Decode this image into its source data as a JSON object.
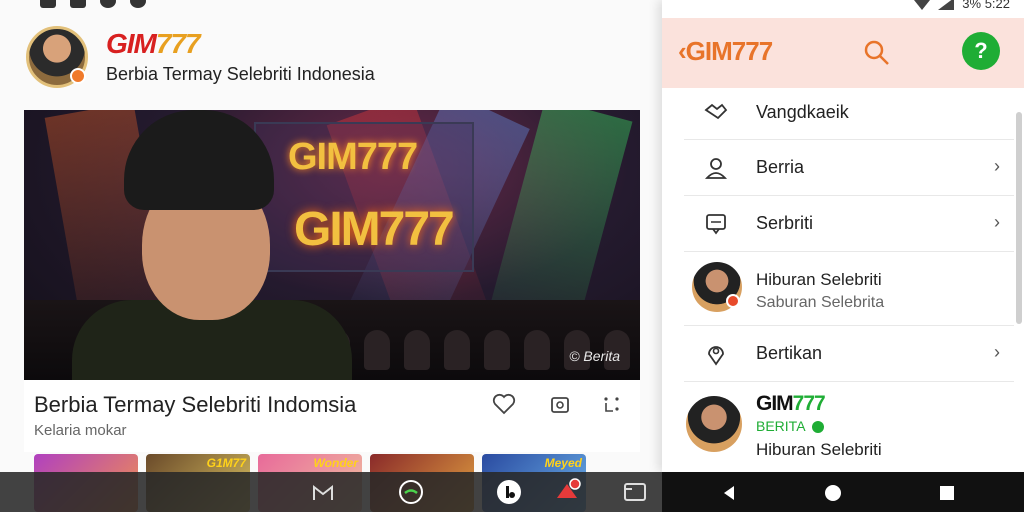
{
  "app": {
    "brand_main": "GIM",
    "brand_accent": "777",
    "subtitle": "Berbia Termay Selebriti Indonesia"
  },
  "hero": {
    "stage_title_top": "GIM777",
    "stage_title_bottom": "GIM777",
    "watermark": "© Berita"
  },
  "caption": {
    "title": "Berbia Termay Selebriti Indomsia",
    "subtitle": "Kelaria mokar"
  },
  "thumbnails": [
    {
      "label": ""
    },
    {
      "label": "G1M77"
    },
    {
      "label": "Wonder"
    },
    {
      "label": ""
    },
    {
      "label": "Meyed"
    }
  ],
  "panel": {
    "status_text": "3%  5:22",
    "back_brand": "GIM777",
    "help_symbol": "?",
    "menu": [
      {
        "label": "Vangdkaeik",
        "icon": "handshake-icon",
        "chevron": false
      },
      {
        "label": "Berria",
        "icon": "person-icon",
        "chevron": true
      },
      {
        "label": "Serbriti",
        "icon": "message-icon",
        "chevron": true
      },
      {
        "title": "Hiburan Selebriti",
        "subtitle": "Saburan Selebrita",
        "icon": "avatar"
      },
      {
        "label": "Bertikan",
        "icon": "location-pin-icon",
        "chevron": true
      }
    ],
    "promo": {
      "title_main": "GIM",
      "title_accent": "777",
      "badge": "BERITA",
      "subtitle": "Hiburan Selebriti"
    },
    "chevron_symbol": "›"
  },
  "colors": {
    "brand_red": "#d82020",
    "brand_orange": "#e8742a",
    "accent_green": "#1fad35",
    "panel_header_bg": "#fbe2dc"
  }
}
